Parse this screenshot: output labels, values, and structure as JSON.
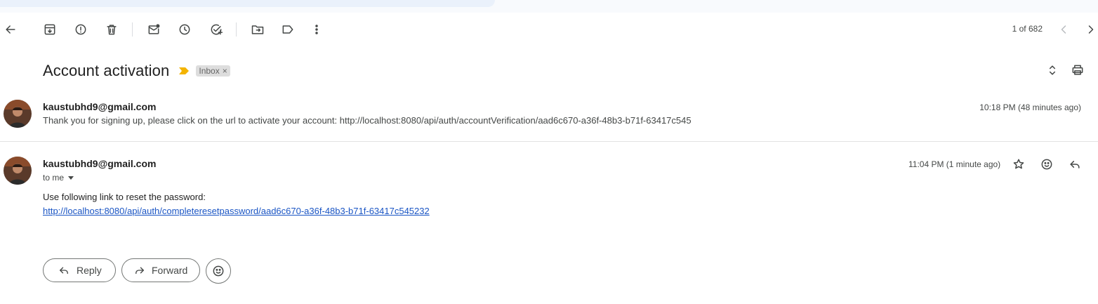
{
  "toolbar": {
    "icons": [
      "back-arrow-icon",
      "archive-icon",
      "report-spam-icon",
      "delete-icon",
      "mark-unread-icon",
      "snooze-icon",
      "add-to-tasks-icon",
      "move-to-icon",
      "label-icon",
      "more-options-icon"
    ],
    "pager_text": "1 of 682"
  },
  "thread": {
    "subject": "Account activation",
    "label": "Inbox",
    "label_remove": "×",
    "importance_color": "#f4b400"
  },
  "messages": [
    {
      "sender": "kaustubhd9@gmail.com",
      "snippet": "Thank you for signing up, please click on the url to activate your account: http://localhost:8080/api/auth/accountVerification/aad6c670-a36f-48b3-b71f-63417c545",
      "time": "10:18 PM (48 minutes ago)"
    },
    {
      "sender": "kaustubhd9@gmail.com",
      "recipient_text": "to me",
      "time": "11:04 PM (1 minute ago)",
      "body_text": "Use following link to reset the password:",
      "body_link": "http://localhost:8080/api/auth/completeresetpassword/aad6c670-a36f-48b3-b71f-63417c545232"
    }
  ],
  "actions": {
    "reply_label": "Reply",
    "forward_label": "Forward"
  },
  "colors": {
    "link": "#1a55c4",
    "label_chip_bg": "#dddddd"
  }
}
